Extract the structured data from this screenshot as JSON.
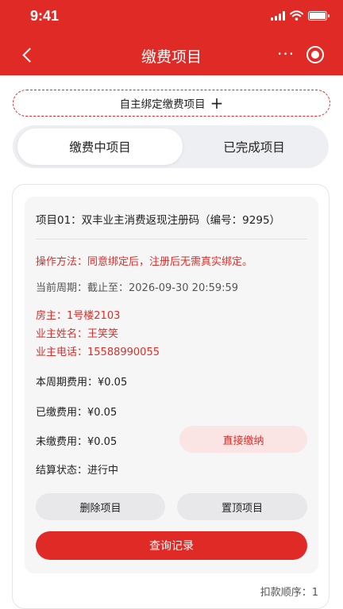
{
  "status_bar": {
    "time": "9:41"
  },
  "nav": {
    "title": "缴费项目",
    "more": "···"
  },
  "bind_button": {
    "label": "自主绑定缴费项目",
    "plus": "+"
  },
  "tabs": [
    {
      "label": "缴费中项目",
      "active": true
    },
    {
      "label": "已完成项目",
      "active": false
    }
  ],
  "project": {
    "title": "项目01：双丰业主消费返现注册码（编号：9295）",
    "method": "操作方法：同意绑定后，注册后无需真实绑定。",
    "cycle": "当前周期：截止至：2026-09-30  20:59:59",
    "owner": "房主：1号楼2103",
    "owner_name": "业主姓名：王笑笑",
    "owner_phone": "业主电话：15588990055",
    "period_fee": "本周期费用：¥0.05",
    "paid_fee": "已缴费用：¥0.05",
    "unpaid_fee": "未缴费用：¥0.05",
    "settle_status": "结算状态：进行中",
    "pay_now_label": "直接缴纳",
    "delete_label": "删除项目",
    "pin_label": "置顶项目",
    "query_label": "查询记录",
    "order": "扣款顺序：1"
  },
  "colors": {
    "brand": "#e02a26",
    "accent_red_text": "#d9302c",
    "pay_now_bg": "#fbe4e4"
  }
}
